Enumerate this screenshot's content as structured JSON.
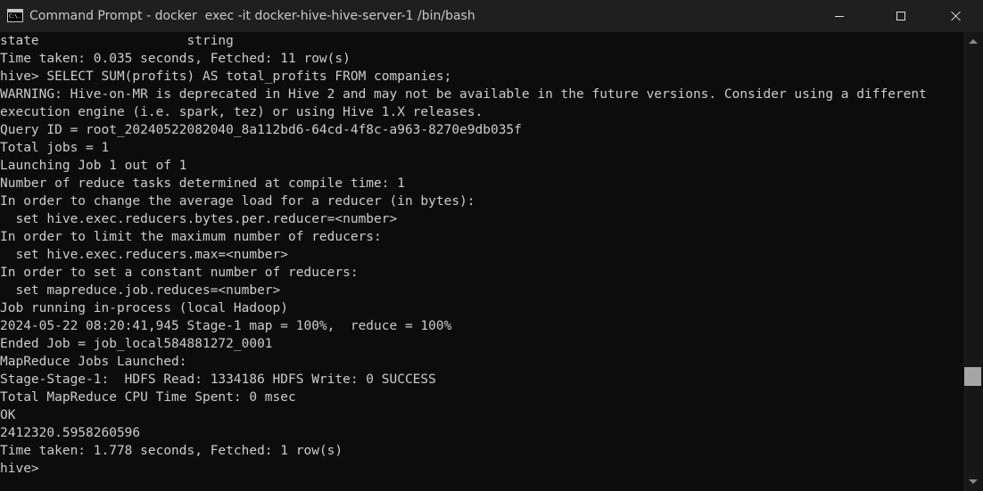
{
  "window": {
    "title": "Command Prompt - docker  exec -it docker-hive-hive-server-1 /bin/bash",
    "icon_text": "C:\\."
  },
  "console": {
    "lines": [
      "state                   string",
      "Time taken: 0.035 seconds, Fetched: 11 row(s)",
      "hive> SELECT SUM(profits) AS total_profits FROM companies;",
      "WARNING: Hive-on-MR is deprecated in Hive 2 and may not be available in the future versions. Consider using a different",
      "execution engine (i.e. spark, tez) or using Hive 1.X releases.",
      "Query ID = root_20240522082040_8a112bd6-64cd-4f8c-a963-8270e9db035f",
      "Total jobs = 1",
      "Launching Job 1 out of 1",
      "Number of reduce tasks determined at compile time: 1",
      "In order to change the average load for a reducer (in bytes):",
      "  set hive.exec.reducers.bytes.per.reducer=<number>",
      "In order to limit the maximum number of reducers:",
      "  set hive.exec.reducers.max=<number>",
      "In order to set a constant number of reducers:",
      "  set mapreduce.job.reduces=<number>",
      "Job running in-process (local Hadoop)",
      "2024-05-22 08:20:41,945 Stage-1 map = 100%,  reduce = 100%",
      "Ended Job = job_local584881272_0001",
      "MapReduce Jobs Launched:",
      "Stage-Stage-1:  HDFS Read: 1334186 HDFS Write: 0 SUCCESS",
      "Total MapReduce CPU Time Spent: 0 msec",
      "OK",
      "2412320.5958260596",
      "Time taken: 1.778 seconds, Fetched: 1 row(s)",
      "hive>"
    ]
  },
  "colors": {
    "background": "#0c0c0c",
    "text": "#cccccc",
    "titlebar": "#1f1f1f"
  }
}
